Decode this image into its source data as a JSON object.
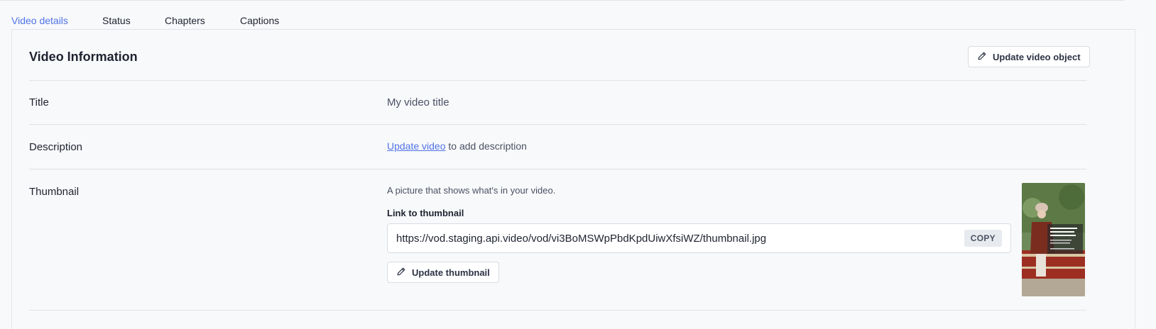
{
  "tabs": [
    {
      "label": "Video details",
      "active": true
    },
    {
      "label": "Status",
      "active": false
    },
    {
      "label": "Chapters",
      "active": false
    },
    {
      "label": "Captions",
      "active": false
    }
  ],
  "section": {
    "title": "Video Information",
    "update_object_label": "Update video object"
  },
  "rows": {
    "title": {
      "label": "Title",
      "value": "My video title"
    },
    "description": {
      "label": "Description",
      "link_text": "Update video",
      "suffix": " to add description"
    },
    "thumbnail": {
      "label": "Thumbnail",
      "hint": "A picture that shows what's in your video.",
      "link_label": "Link to thumbnail",
      "url": "https://vod.staging.api.video/vod/vi3BoMSWpPbdKpdUiwXfsiWZ/thumbnail.jpg",
      "copy_label": "COPY",
      "update_label": "Update thumbnail"
    }
  },
  "colors": {
    "accent": "#4f73e8",
    "background": "#f8f9fb",
    "divider": "#dfe2e8"
  },
  "icons": {
    "update_object": "pencil-icon",
    "update_thumbnail": "pencil-icon"
  }
}
